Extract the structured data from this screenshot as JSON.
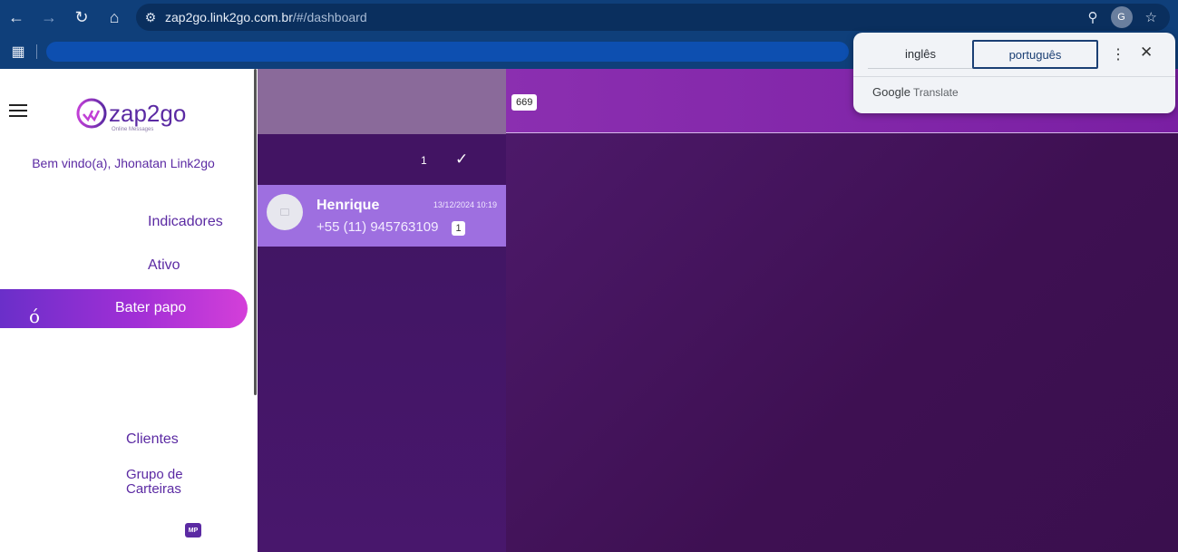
{
  "browser": {
    "url_host": "zap2go.link2go.com.br",
    "url_path": "/#/dashboard"
  },
  "translate_popup": {
    "source_lang": "inglês",
    "target_lang": "português",
    "brand_google": "Google",
    "brand_product": "Translate"
  },
  "sidebar": {
    "logo_text": "zap2go",
    "logo_tagline": "Online Messages",
    "welcome": "Bem vindo(a), Jhonatan Link2go",
    "items": [
      {
        "label": "Indicadores"
      },
      {
        "label": "Ativo"
      },
      {
        "label": "Bater papo",
        "glyph": "ó"
      },
      {
        "label": "Clientes"
      },
      {
        "label": "Grupo de Carteiras"
      }
    ],
    "badge": "MP"
  },
  "chat_list": {
    "count": "1",
    "chats": [
      {
        "name": "Henrique",
        "time": "13/12/2024 10:19",
        "phone": "+55 (11) 945763109",
        "unread": "1"
      }
    ]
  },
  "main": {
    "counter": "669"
  },
  "colors": {
    "chrome": "#0f3f7a",
    "accent": "#5b2aa3",
    "active_gradient_start": "#6a2fc9",
    "active_gradient_end": "#d43fd9",
    "chat_selected": "#9e6fe0"
  }
}
